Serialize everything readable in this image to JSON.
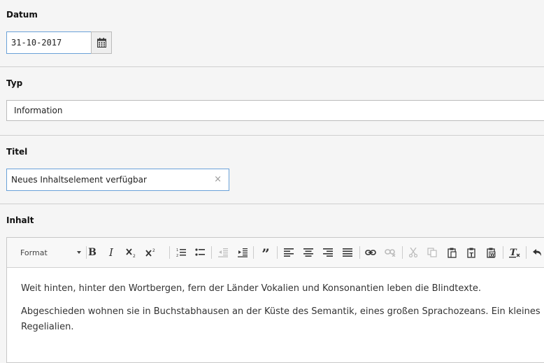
{
  "datum": {
    "label": "Datum",
    "value": "31-10-2017"
  },
  "typ": {
    "label": "Typ",
    "value": "Information"
  },
  "titel": {
    "label": "Titel",
    "value": "Neues Inhaltselement verfügbar",
    "clear": "×"
  },
  "inhalt": {
    "label": "Inhalt",
    "toolbar": {
      "format_label": "Format",
      "bold": "B",
      "italic": "I",
      "blockquote": "”",
      "buttons": [
        "bold",
        "italic",
        "subscript",
        "superscript",
        "numbered-list",
        "bulleted-list",
        "decrease-indent",
        "increase-indent",
        "blockquote",
        "align-left",
        "align-center",
        "align-right",
        "justify",
        "link",
        "unlink",
        "cut",
        "copy",
        "paste",
        "paste-text",
        "paste-word",
        "remove-format",
        "undo"
      ]
    },
    "paragraphs": [
      "Weit hinten, hinter den Wortbergen, fern der Länder Vokalien und Konsonantien leben die Blindtexte.",
      "Abgeschieden wohnen sie in Buchstabhausen an der Küste des Semantik, eines großen Sprachozeans. Ein kleines B",
      "Regelialien."
    ]
  }
}
